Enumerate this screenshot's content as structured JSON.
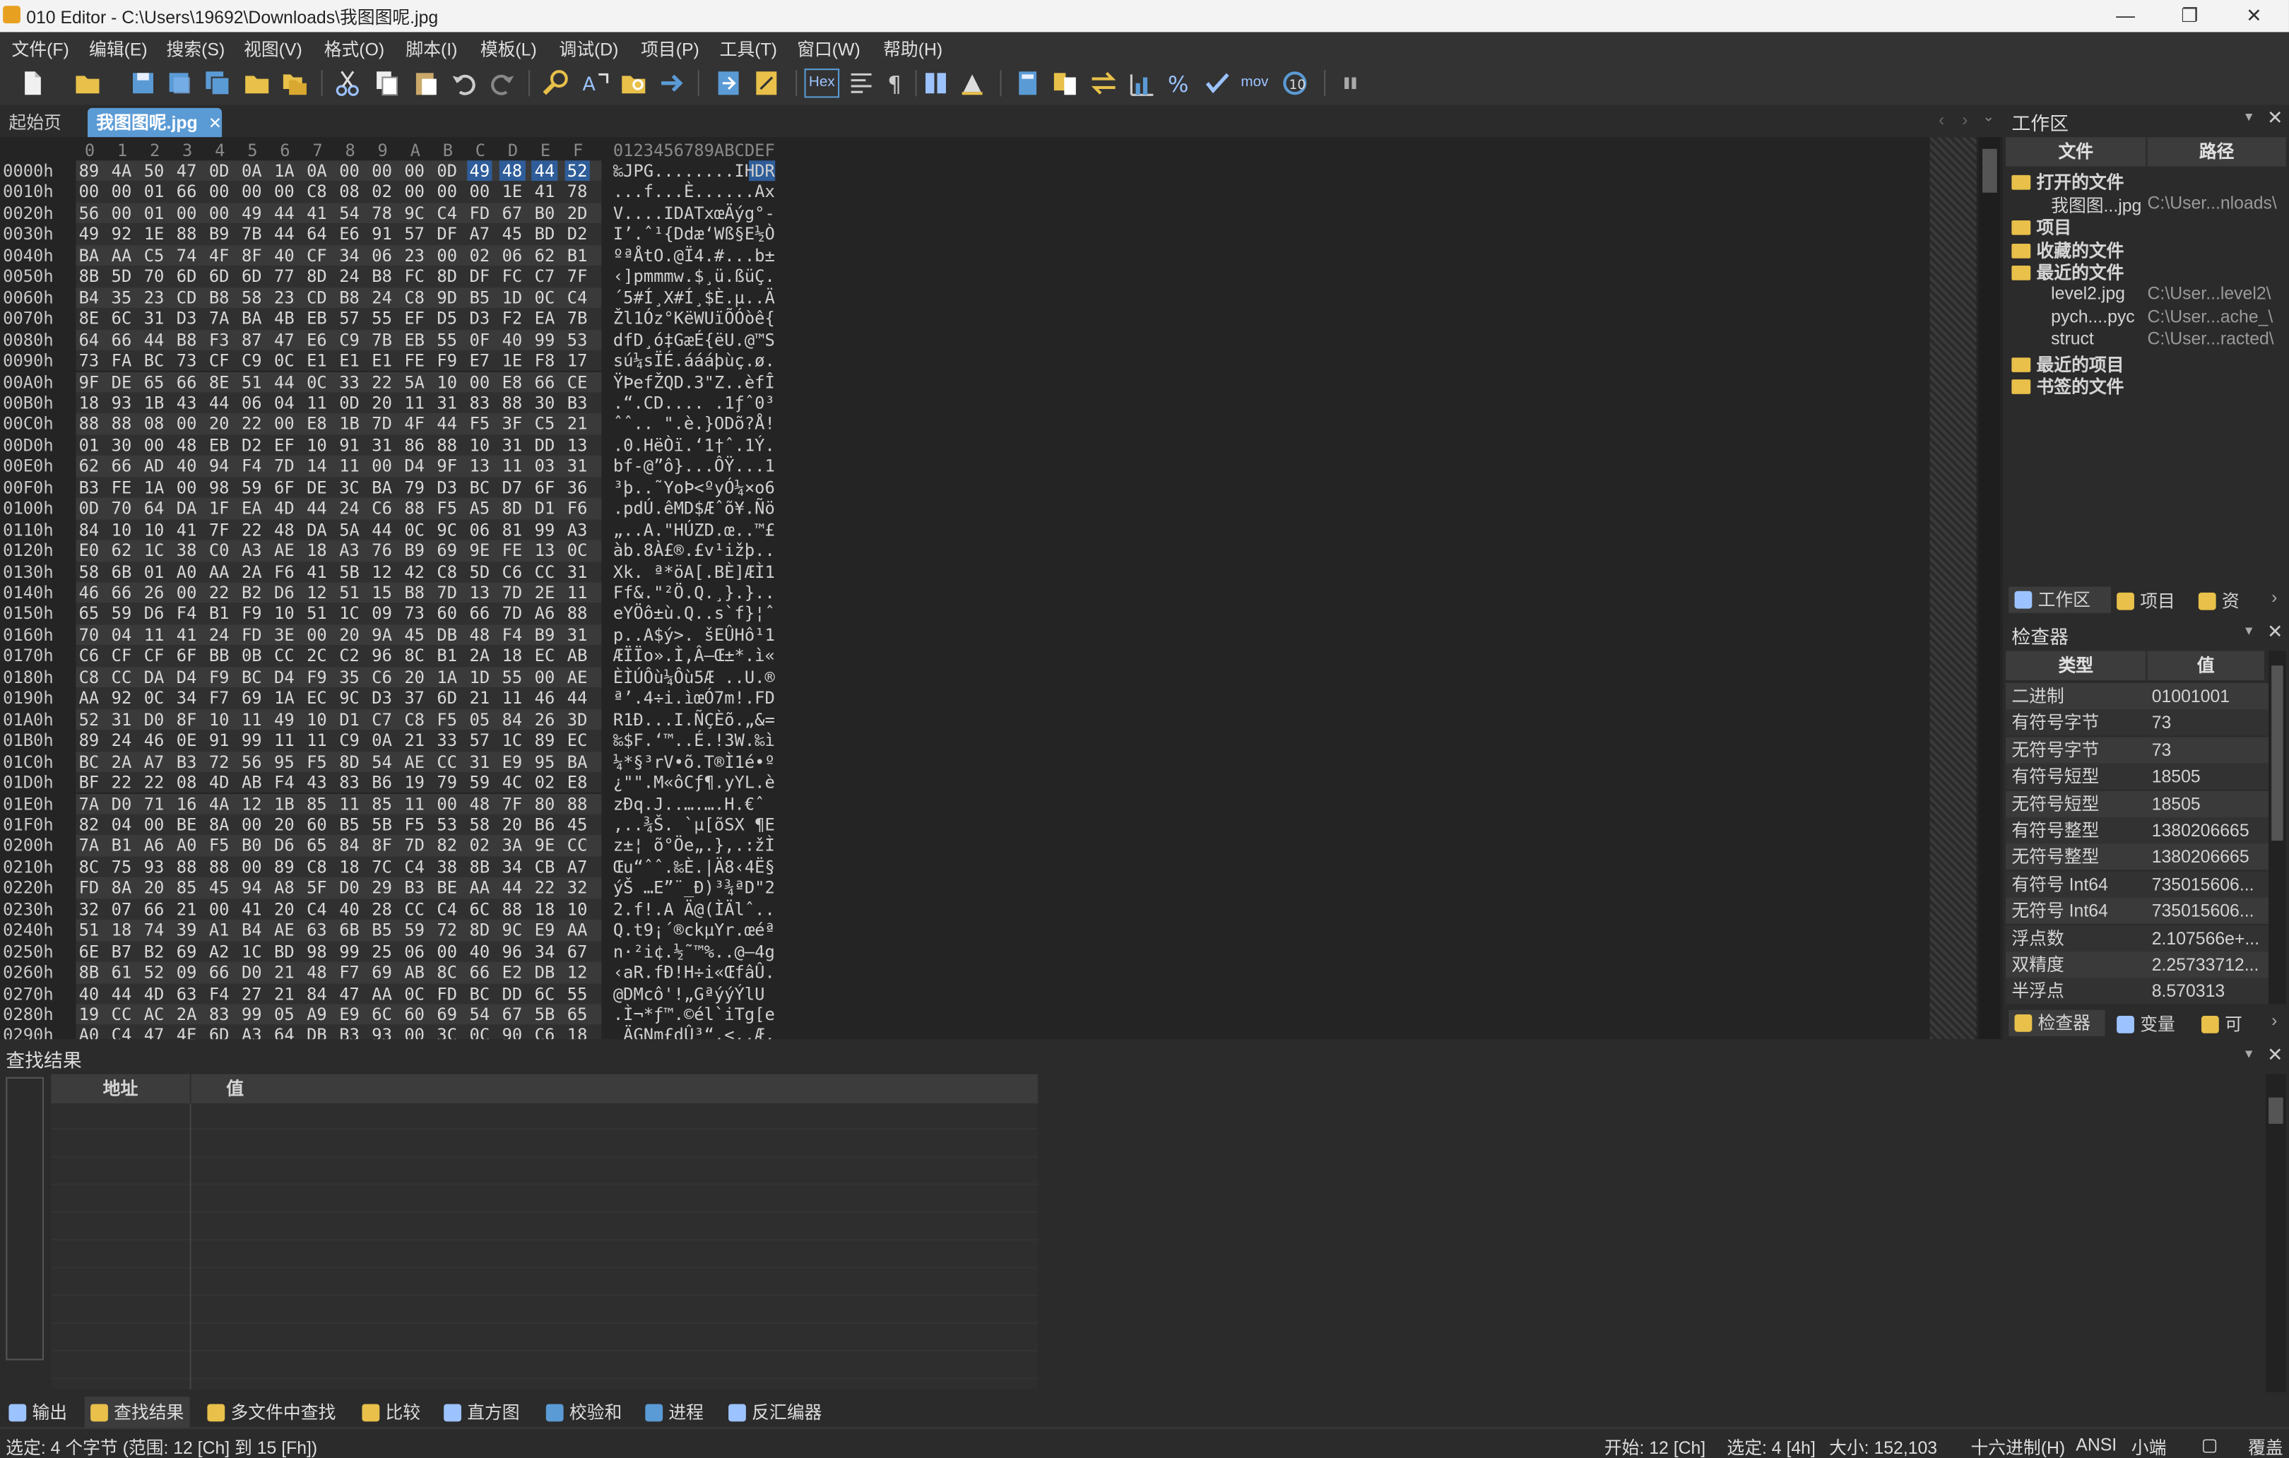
{
  "window": {
    "title": "010 Editor - C:\\Users\\19692\\Downloads\\我图图呢.jpg",
    "controls": {
      "minimize": "—",
      "restore": "❐",
      "close": "✕"
    }
  },
  "menu": [
    "文件(F)",
    "编辑(E)",
    "搜索(S)",
    "视图(V)",
    "格式(O)",
    "脚本(I)",
    "模板(L)",
    "调试(D)",
    "项目(P)",
    "工具(T)",
    "窗口(W)",
    "帮助(H)"
  ],
  "toolbar": {
    "hex_label": "Hex",
    "mov_label": "mov",
    "icons": [
      "new-file-icon",
      "open-file-icon",
      "save-icon",
      "save-as-icon",
      "save-all-icon",
      "open-folder-icon",
      "folders-icon",
      "cut-icon",
      "copy-icon",
      "paste-icon",
      "undo-icon",
      "redo-icon",
      "find-icon",
      "replace-icon",
      "find-in-files-icon",
      "goto-icon",
      "template-icon",
      "script-icon",
      "hex-mode-icon",
      "columns-icon",
      "pilcrow-icon",
      "split-icon",
      "highlight-icon",
      "calculator-icon",
      "compare-icon",
      "convert-icon",
      "histogram-icon",
      "percent-icon",
      "checksum-icon",
      "mov-icon",
      "endian-icon",
      "pause-icon"
    ]
  },
  "tabs": {
    "start": "起始页",
    "file": "我图图呢.jpg",
    "close_glyph": "✕"
  },
  "hex": {
    "header_cols": [
      "0",
      "1",
      "2",
      "3",
      "4",
      "5",
      "6",
      "7",
      "8",
      "9",
      "A",
      "B",
      "C",
      "D",
      "E",
      "F"
    ],
    "ascii_header": "0123456789ABCDEF",
    "rows": [
      {
        "addr": "0000h",
        "bytes": [
          "89",
          "4A",
          "50",
          "47",
          "0D",
          "0A",
          "1A",
          "0A",
          "00",
          "00",
          "00",
          "0D",
          "49",
          "48",
          "44",
          "52"
        ],
        "ascii": "‰JPG........IHDR"
      },
      {
        "addr": "0010h",
        "bytes": [
          "00",
          "00",
          "01",
          "66",
          "00",
          "00",
          "00",
          "C8",
          "08",
          "02",
          "00",
          "00",
          "00",
          "1E",
          "41",
          "78"
        ],
        "ascii": "...f...È......Ax"
      },
      {
        "addr": "0020h",
        "bytes": [
          "56",
          "00",
          "01",
          "00",
          "00",
          "49",
          "44",
          "41",
          "54",
          "78",
          "9C",
          "C4",
          "FD",
          "67",
          "B0",
          "2D"
        ],
        "ascii": "V....IDATxœÄýg°-"
      },
      {
        "addr": "0030h",
        "bytes": [
          "49",
          "92",
          "1E",
          "88",
          "B9",
          "7B",
          "44",
          "64",
          "E6",
          "91",
          "57",
          "DF",
          "A7",
          "45",
          "BD",
          "D2"
        ],
        "ascii": "I’.ˆ¹{DdæʻWß§E½Ò"
      },
      {
        "addr": "0040h",
        "bytes": [
          "BA",
          "AA",
          "C5",
          "74",
          "4F",
          "8F",
          "40",
          "CF",
          "34",
          "06",
          "23",
          "00",
          "02",
          "06",
          "62",
          "B1"
        ],
        "ascii": "ºªÅtO.@Ï4.#...b±"
      },
      {
        "addr": "0050h",
        "bytes": [
          "8B",
          "5D",
          "70",
          "6D",
          "6D",
          "6D",
          "77",
          "8D",
          "24",
          "B8",
          "FC",
          "8D",
          "DF",
          "FC",
          "C7",
          "7F"
        ],
        "ascii": "‹]pmmmw.$¸ü.ßüÇ."
      },
      {
        "addr": "0060h",
        "bytes": [
          "B4",
          "35",
          "23",
          "CD",
          "B8",
          "58",
          "23",
          "CD",
          "B8",
          "24",
          "C8",
          "9D",
          "B5",
          "1D",
          "0C",
          "C4"
        ],
        "ascii": "´5#Í¸X#Í¸$È.µ..Ä"
      },
      {
        "addr": "0070h",
        "bytes": [
          "8E",
          "6C",
          "31",
          "D3",
          "7A",
          "BA",
          "4B",
          "EB",
          "57",
          "55",
          "EF",
          "D5",
          "D3",
          "F2",
          "EA",
          "7B"
        ],
        "ascii": "Žl1Óz°KëWUïÕÓòê{"
      },
      {
        "addr": "0080h",
        "bytes": [
          "64",
          "66",
          "44",
          "B8",
          "F3",
          "87",
          "47",
          "E6",
          "C9",
          "7B",
          "EB",
          "55",
          "0F",
          "40",
          "99",
          "53"
        ],
        "ascii": "dfD¸ó‡GæÉ{ëU.@™S"
      },
      {
        "addr": "0090h",
        "bytes": [
          "73",
          "FA",
          "BC",
          "73",
          "CF",
          "C9",
          "0C",
          "E1",
          "E1",
          "E1",
          "FE",
          "F9",
          "E7",
          "1E",
          "F8",
          "17"
        ],
        "ascii": "sú¼sÏÉ.áááþùç.ø."
      },
      {
        "addr": "00A0h",
        "bytes": [
          "9F",
          "DE",
          "65",
          "66",
          "8E",
          "51",
          "44",
          "0C",
          "33",
          "22",
          "5A",
          "10",
          "00",
          "E8",
          "66",
          "CE"
        ],
        "ascii": "ŸÞefŽQD.3\"Z..èfÎ"
      },
      {
        "addr": "00B0h",
        "bytes": [
          "18",
          "93",
          "1B",
          "43",
          "44",
          "06",
          "04",
          "11",
          "0D",
          "20",
          "11",
          "31",
          "83",
          "88",
          "30",
          "B3"
        ],
        "ascii": ".“.CD.... .1ƒˆ0³"
      },
      {
        "addr": "00C0h",
        "bytes": [
          "88",
          "88",
          "08",
          "00",
          "20",
          "22",
          "00",
          "E8",
          "1B",
          "7D",
          "4F",
          "44",
          "F5",
          "3F",
          "C5",
          "21"
        ],
        "ascii": "ˆˆ.. \".è.}ODõ?Å!"
      },
      {
        "addr": "00D0h",
        "bytes": [
          "01",
          "30",
          "00",
          "48",
          "EB",
          "D2",
          "EF",
          "10",
          "91",
          "31",
          "86",
          "88",
          "10",
          "31",
          "DD",
          "13"
        ],
        "ascii": ".0.HëÒï.‘1†ˆ.1Ý."
      },
      {
        "addr": "00E0h",
        "bytes": [
          "62",
          "66",
          "AD",
          "40",
          "94",
          "F4",
          "7D",
          "14",
          "11",
          "00",
          "D4",
          "9F",
          "13",
          "11",
          "03",
          "31"
        ],
        "ascii": "bf-@”ô}...ÔŸ...1"
      },
      {
        "addr": "00F0h",
        "bytes": [
          "B3",
          "FE",
          "1A",
          "00",
          "98",
          "59",
          "6F",
          "DE",
          "3C",
          "BA",
          "79",
          "D3",
          "BC",
          "D7",
          "6F",
          "36"
        ],
        "ascii": "³þ..˜YoÞ<ºyÓ¼×o6"
      },
      {
        "addr": "0100h",
        "bytes": [
          "0D",
          "70",
          "64",
          "DA",
          "1F",
          "EA",
          "4D",
          "44",
          "24",
          "C6",
          "88",
          "F5",
          "A5",
          "8D",
          "D1",
          "F6"
        ],
        "ascii": ".pdÚ.êMD$Æˆõ¥.Ñö"
      },
      {
        "addr": "0110h",
        "bytes": [
          "84",
          "10",
          "10",
          "41",
          "7F",
          "22",
          "48",
          "DA",
          "5A",
          "44",
          "0C",
          "9C",
          "06",
          "81",
          "99",
          "A3"
        ],
        "ascii": "„..A.\"HÚZD.œ..™£"
      },
      {
        "addr": "0120h",
        "bytes": [
          "E0",
          "62",
          "1C",
          "38",
          "C0",
          "A3",
          "AE",
          "18",
          "A3",
          "76",
          "B9",
          "69",
          "9E",
          "FE",
          "13",
          "0C"
        ],
        "ascii": "àb.8À£®.£v¹ižþ.."
      },
      {
        "addr": "0130h",
        "bytes": [
          "58",
          "6B",
          "01",
          "A0",
          "AA",
          "2A",
          "F6",
          "41",
          "5B",
          "12",
          "42",
          "C8",
          "5D",
          "C6",
          "CC",
          "31"
        ],
        "ascii": "Xk. ª*öA[.BÈ]ÆÌ1"
      },
      {
        "addr": "0140h",
        "bytes": [
          "46",
          "66",
          "26",
          "00",
          "22",
          "B2",
          "D6",
          "12",
          "51",
          "15",
          "B8",
          "7D",
          "13",
          "7D",
          "2E",
          "11"
        ],
        "ascii": "Ff&.\"²Ö.Q.¸}.}.."
      },
      {
        "addr": "0150h",
        "bytes": [
          "65",
          "59",
          "D6",
          "F4",
          "B1",
          "F9",
          "10",
          "51",
          "1C",
          "09",
          "73",
          "60",
          "66",
          "7D",
          "A6",
          "88"
        ],
        "ascii": "eYÖô±ù.Q..s`f}¦ˆ"
      },
      {
        "addr": "0160h",
        "bytes": [
          "70",
          "04",
          "11",
          "41",
          "24",
          "FD",
          "3E",
          "00",
          "20",
          "9A",
          "45",
          "DB",
          "48",
          "F4",
          "B9",
          "31"
        ],
        "ascii": "p..A$ý>. šEÛHô¹1"
      },
      {
        "addr": "0170h",
        "bytes": [
          "C6",
          "CF",
          "CF",
          "6F",
          "BB",
          "0B",
          "CC",
          "2C",
          "C2",
          "96",
          "8C",
          "B1",
          "2A",
          "18",
          "EC",
          "AB"
        ],
        "ascii": "ÆÏÏo».Ì,Â–Œ±*.ì«"
      },
      {
        "addr": "0180h",
        "bytes": [
          "C8",
          "CC",
          "DA",
          "D4",
          "F9",
          "BC",
          "D4",
          "F9",
          "35",
          "C6",
          "20",
          "1A",
          "1D",
          "55",
          "00",
          "AE"
        ],
        "ascii": "ÈÌÚÔù¼Ôù5Æ ..U.®"
      },
      {
        "addr": "0190h",
        "bytes": [
          "AA",
          "92",
          "0C",
          "34",
          "F7",
          "69",
          "1A",
          "EC",
          "9C",
          "D3",
          "37",
          "6D",
          "21",
          "11",
          "46",
          "44"
        ],
        "ascii": "ª’.4÷i.ìœÓ7m!.FD"
      },
      {
        "addr": "01A0h",
        "bytes": [
          "52",
          "31",
          "D0",
          "8F",
          "10",
          "11",
          "49",
          "10",
          "D1",
          "C7",
          "C8",
          "F5",
          "05",
          "84",
          "26",
          "3D"
        ],
        "ascii": "R1Ð...I.ÑÇÈõ.„&="
      },
      {
        "addr": "01B0h",
        "bytes": [
          "89",
          "24",
          "46",
          "0E",
          "91",
          "99",
          "11",
          "11",
          "C9",
          "0A",
          "21",
          "33",
          "57",
          "1C",
          "89",
          "EC"
        ],
        "ascii": "‰$F.‘™..É.!3W.‰ì"
      },
      {
        "addr": "01C0h",
        "bytes": [
          "BC",
          "2A",
          "A7",
          "B3",
          "72",
          "56",
          "95",
          "F5",
          "8D",
          "54",
          "AE",
          "CC",
          "31",
          "E9",
          "95",
          "BA"
        ],
        "ascii": "¼*§³rV•õ.T®Ì1é•º"
      },
      {
        "addr": "01D0h",
        "bytes": [
          "BF",
          "22",
          "22",
          "08",
          "4D",
          "AB",
          "F4",
          "43",
          "83",
          "B6",
          "19",
          "79",
          "59",
          "4C",
          "02",
          "E8"
        ],
        "ascii": "¿\"\".M«ôCƒ¶.yYL.è"
      },
      {
        "addr": "01E0h",
        "bytes": [
          "7A",
          "D0",
          "71",
          "16",
          "4A",
          "12",
          "1B",
          "85",
          "11",
          "85",
          "11",
          "00",
          "48",
          "7F",
          "80",
          "88"
        ],
        "ascii": "zÐq.J..….….H.€ˆ"
      },
      {
        "addr": "01F0h",
        "bytes": [
          "82",
          "04",
          "00",
          "BE",
          "8A",
          "00",
          "20",
          "60",
          "B5",
          "5B",
          "F5",
          "53",
          "58",
          "20",
          "B6",
          "45"
        ],
        "ascii": "‚..¾Š. `µ[õSX ¶E"
      },
      {
        "addr": "0200h",
        "bytes": [
          "7A",
          "B1",
          "A6",
          "A0",
          "F5",
          "B0",
          "D6",
          "65",
          "84",
          "8F",
          "7D",
          "82",
          "02",
          "3A",
          "9E",
          "CC"
        ],
        "ascii": "z±¦ õ°Öe„.}‚.:žÌ"
      },
      {
        "addr": "0210h",
        "bytes": [
          "8C",
          "75",
          "93",
          "88",
          "88",
          "00",
          "89",
          "C8",
          "18",
          "7C",
          "C4",
          "38",
          "8B",
          "34",
          "CB",
          "A7"
        ],
        "ascii": "Œu“ˆˆ.‰È.|Ä8‹4Ë§"
      },
      {
        "addr": "0220h",
        "bytes": [
          "FD",
          "8A",
          "20",
          "85",
          "45",
          "94",
          "A8",
          "5F",
          "D0",
          "29",
          "B3",
          "BE",
          "AA",
          "44",
          "22",
          "32"
        ],
        "ascii": "ýŠ …E”¨_Ð)³¾ªD\"2"
      },
      {
        "addr": "0230h",
        "bytes": [
          "32",
          "07",
          "66",
          "21",
          "00",
          "41",
          "20",
          "C4",
          "40",
          "28",
          "CC",
          "C4",
          "6C",
          "88",
          "18",
          "10"
        ],
        "ascii": "2.f!.A Ä@(ÌÄlˆ.."
      },
      {
        "addr": "0240h",
        "bytes": [
          "51",
          "18",
          "74",
          "39",
          "A1",
          "B4",
          "AE",
          "63",
          "6B",
          "B5",
          "59",
          "72",
          "8D",
          "9C",
          "E9",
          "AA"
        ],
        "ascii": "Q.t9¡´®ckµYr.œéª"
      },
      {
        "addr": "0250h",
        "bytes": [
          "6E",
          "B7",
          "B2",
          "69",
          "A2",
          "1C",
          "BD",
          "98",
          "99",
          "25",
          "06",
          "00",
          "40",
          "96",
          "34",
          "67"
        ],
        "ascii": "n·²i¢.½˜™%..@–4g"
      },
      {
        "addr": "0260h",
        "bytes": [
          "8B",
          "61",
          "52",
          "09",
          "66",
          "D0",
          "21",
          "48",
          "F7",
          "69",
          "AB",
          "8C",
          "66",
          "E2",
          "DB",
          "12"
        ],
        "ascii": "‹aR.fÐ!H÷i«ŒfâÛ."
      },
      {
        "addr": "0270h",
        "bytes": [
          "40",
          "44",
          "4D",
          "63",
          "F4",
          "27",
          "21",
          "84",
          "47",
          "AA",
          "0C",
          "FD",
          "BC",
          "DD",
          "6C",
          "55"
        ],
        "ascii": "@DMcô'!„GªýýÝlU"
      },
      {
        "addr": "0280h",
        "bytes": [
          "19",
          "CC",
          "AC",
          "2A",
          "83",
          "99",
          "05",
          "A9",
          "E9",
          "6C",
          "60",
          "69",
          "54",
          "67",
          "5B",
          "65"
        ],
        "ascii": ".Ì¬*ƒ™.©él`iTg[e"
      },
      {
        "addr": "0290h",
        "bytes": [
          "A0",
          "C4",
          "47",
          "4E",
          "6D",
          "A3",
          "64",
          "DB",
          "B3",
          "93",
          "00",
          "3C",
          "0C",
          "90",
          "C6",
          "18"
        ],
        "ascii": " ÄGNm£dÛ³“.<..Æ."
      }
    ]
  },
  "workspace": {
    "title": "工作区",
    "col_file": "文件",
    "col_path": "路径",
    "groups": [
      {
        "label": "打开的文件",
        "items": [
          {
            "name": "我图图...jpg",
            "path": "C:\\User...nloads\\"
          }
        ]
      },
      {
        "label": "项目",
        "items": []
      },
      {
        "label": "收藏的文件",
        "items": []
      },
      {
        "label": "最近的文件",
        "items": [
          {
            "name": "level2.jpg",
            "path": "C:\\User...level2\\"
          },
          {
            "name": "pych....pyc",
            "path": "C:\\User...ache_\\"
          },
          {
            "name": "struct",
            "path": "C:\\User...racted\\"
          }
        ]
      },
      {
        "label": "最近的项目",
        "items": []
      },
      {
        "label": "书签的文件",
        "items": []
      }
    ],
    "tabs": [
      "工作区",
      "项目",
      "资"
    ]
  },
  "inspector": {
    "title": "检查器",
    "col_type": "类型",
    "col_value": "值",
    "rows": [
      {
        "k": "二进制",
        "v": "01001001"
      },
      {
        "k": "有符号字节",
        "v": "73"
      },
      {
        "k": "无符号字节",
        "v": "73"
      },
      {
        "k": "有符号短型",
        "v": "18505"
      },
      {
        "k": "无符号短型",
        "v": "18505"
      },
      {
        "k": "有符号整型",
        "v": "1380206665"
      },
      {
        "k": "无符号整型",
        "v": "1380206665"
      },
      {
        "k": "有符号 Int64",
        "v": "735015606..."
      },
      {
        "k": "无符号 Int64",
        "v": "735015606..."
      },
      {
        "k": "浮点数",
        "v": "2.107566e+..."
      },
      {
        "k": "双精度",
        "v": "2.25733712..."
      },
      {
        "k": "半浮点",
        "v": "8.570313"
      }
    ],
    "tabs": [
      "检查器",
      "变量",
      "可"
    ]
  },
  "find": {
    "title": "查找结果",
    "col_addr": "地址",
    "col_value": "值"
  },
  "bottom_tabs": [
    "输出",
    "查找结果",
    "多文件中查找",
    "比较",
    "直方图",
    "校验和",
    "进程",
    "反汇编器"
  ],
  "status": {
    "selection": "选定: 4 个字节 (范围: 12 [Ch] 到 15 [Fh])",
    "start": "开始: 12 [Ch]",
    "selected": "选定: 4 [4h]",
    "size": "大小: 152,103",
    "mode": "十六进制(H)",
    "encoding": "ANSI",
    "endian": "小端",
    "overwrite": "覆盖"
  },
  "colors": {
    "selection": "#2f5d9a",
    "accent": "#3c78c8",
    "folder": "#e8c04a"
  }
}
